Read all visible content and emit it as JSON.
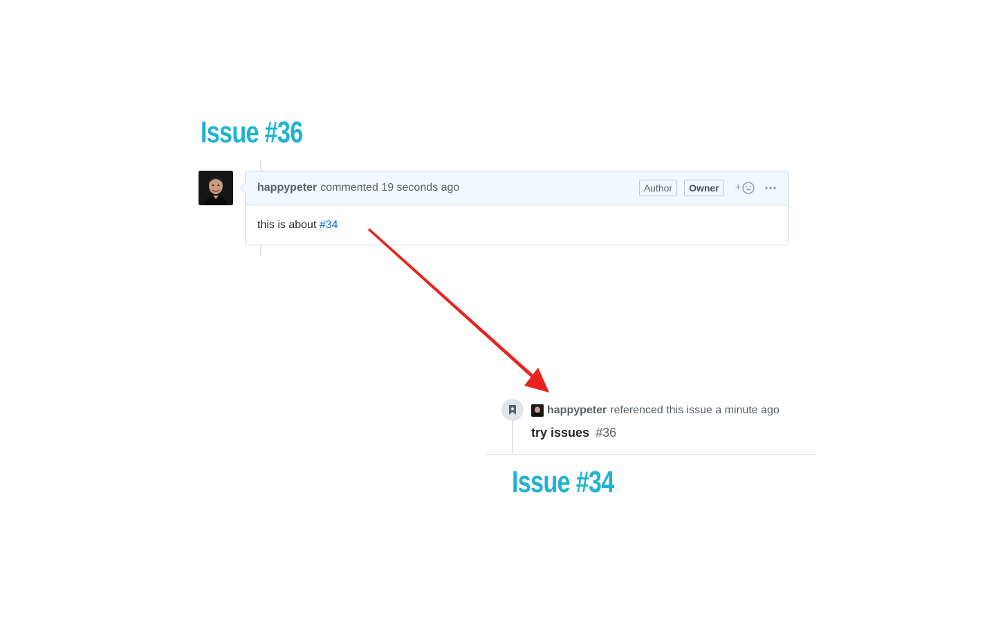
{
  "headings": {
    "issue_a": "Issue #36",
    "issue_b": "Issue #34"
  },
  "comment": {
    "author": "happypeter",
    "meta": "commented 19 seconds ago",
    "badges": {
      "author": "Author",
      "owner": "Owner"
    },
    "react_plus": "+",
    "body_text": "this is about ",
    "body_link": "#34"
  },
  "reference": {
    "author": "happypeter",
    "meta": "referenced this issue a minute ago",
    "title": "try issues",
    "number": "#36"
  },
  "colors": {
    "heading": "#1fb3d1",
    "arrow": "#e8231e",
    "link": "#0366d6",
    "header_bg": "#f1f8ff",
    "border": "#c0d3eb"
  },
  "icons": {
    "react": "smiley-icon",
    "menu": "kebab-horizontal-icon",
    "event": "bookmark-icon"
  }
}
